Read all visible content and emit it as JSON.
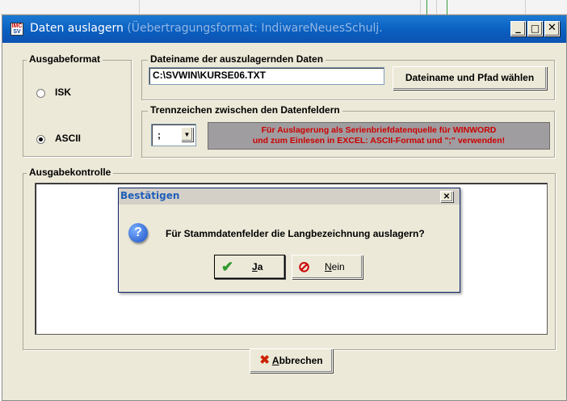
{
  "window": {
    "title": "Daten auslagern",
    "title_suffix": " (Üebertragungsformat: IndiwareNeuesSchulj.",
    "icon_text_top": "IMC",
    "icon_text_bottom": "SV",
    "minimize_symbol": "_",
    "maximize_symbol": "□",
    "close_symbol": "✕"
  },
  "ausgabeformat": {
    "label": "Ausgabeformat",
    "options": [
      {
        "label": "ISK",
        "checked": false
      },
      {
        "label": "ASCII",
        "checked": true
      }
    ]
  },
  "dateiname": {
    "label": "Dateiname der auszulagernden Daten",
    "value": "C:\\SVWIN\\KURSE06.TXT",
    "button_label": "Dateiname und Pfad wählen"
  },
  "trennzeichen": {
    "label": "Trennzeichen zwischen den Datenfeldern",
    "selected": ";",
    "dropdown_arrow": "▼",
    "hint_line1": "Für Auslagerung als Serienbriefdatenquelle für WINWORD",
    "hint_line2": "und zum Einlesen in EXCEL:   ASCII-Format und \";\" verwenden!"
  },
  "ausgabekontrolle": {
    "label": "Ausgabekontrolle"
  },
  "abbrechen_button": {
    "icon": "✖",
    "label_first": "A",
    "label_rest": "bbrechen",
    "icon_color": "#cc2200"
  },
  "dialog": {
    "title": "Bestätigen",
    "close_symbol": "✕",
    "question_icon": "?",
    "message": "Für Stammdatenfelder die Langbezeichnung auslagern?",
    "yes": {
      "icon": "✔",
      "label_first": "J",
      "label_rest": "a",
      "icon_color": "#2e9a2e"
    },
    "no": {
      "icon": "⊘",
      "label_first": "N",
      "label_rest": "ein",
      "icon_color": "#cc0000"
    }
  },
  "colors": {
    "titlebar": "#0a5fc0",
    "window_bg": "#ece9d8",
    "dialog_title": "#1f5fb9"
  }
}
